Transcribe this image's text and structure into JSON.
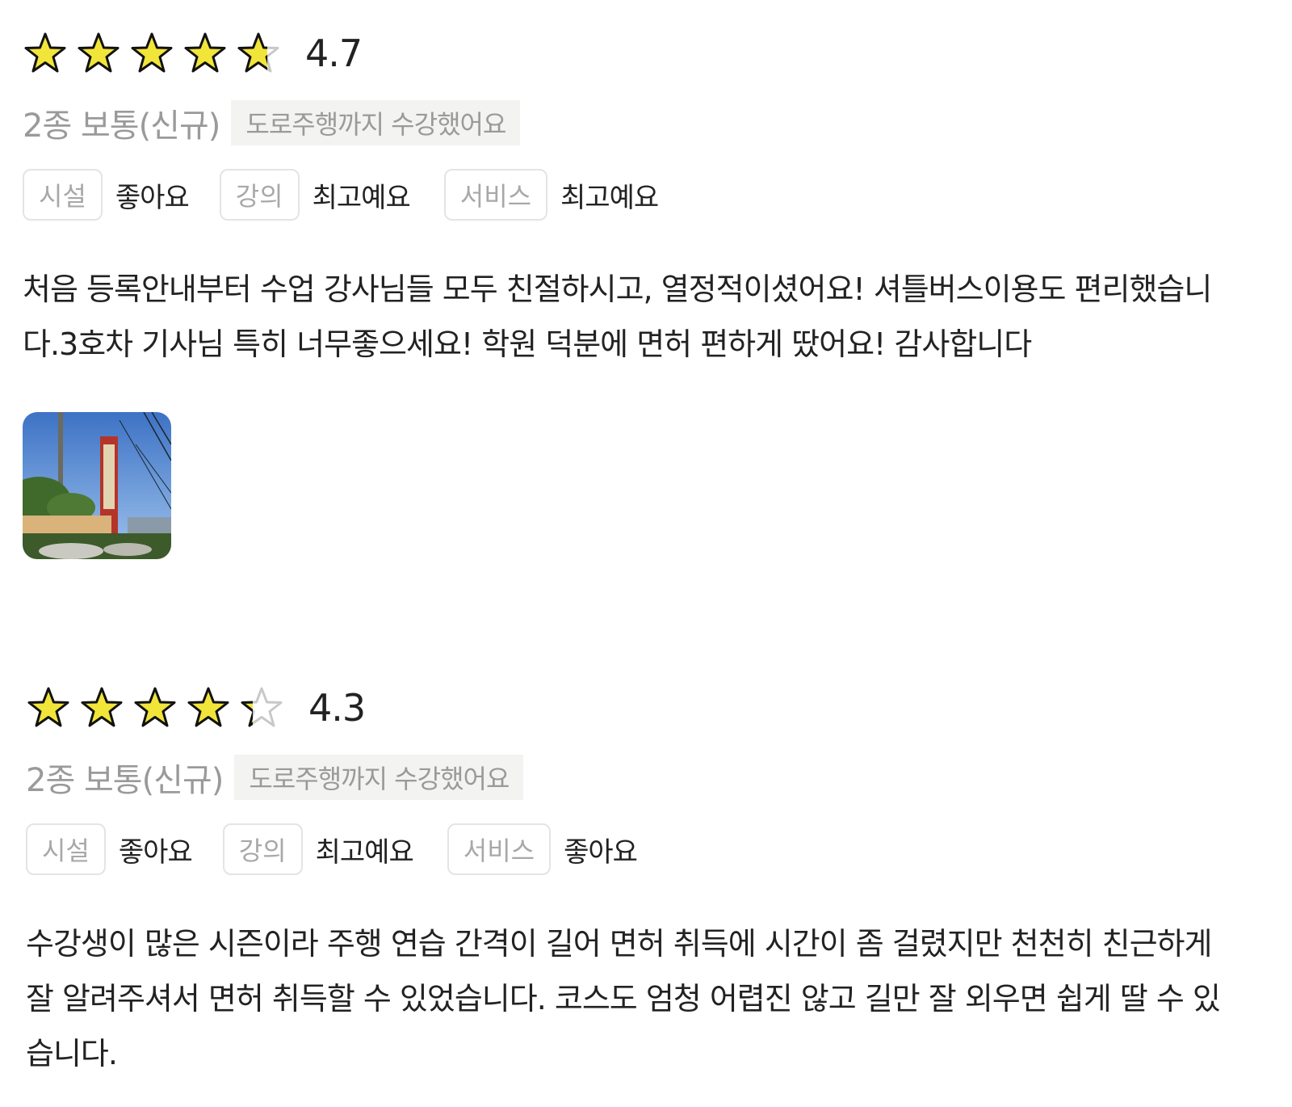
{
  "reviews": [
    {
      "rating": 4.7,
      "score_label": "4.7",
      "course": "2종 보통(신규)",
      "course_tag": "도로주행까지 수강했어요",
      "evaluations": [
        {
          "label": "시설",
          "value": "좋아요"
        },
        {
          "label": "강의",
          "value": "최고예요"
        },
        {
          "label": "서비스",
          "value": "최고예요"
        }
      ],
      "text": "처음 등록안내부터 수업 강사님들 모두 친절하시고, 열정적이셨어요! 셔틀버스이용도 편리했습니다.3호차 기사님 특히 너무좋으세요! 학원 덕분에 면허 편하게 땄어요! 감사합니다",
      "has_photo": true
    },
    {
      "rating": 4.3,
      "score_label": "4.3",
      "course": "2종 보통(신규)",
      "course_tag": "도로주행까지 수강했어요",
      "evaluations": [
        {
          "label": "시설",
          "value": "좋아요"
        },
        {
          "label": "강의",
          "value": "최고예요"
        },
        {
          "label": "서비스",
          "value": "좋아요"
        }
      ],
      "text": "수강생이 많은 시즌이라 주행 연습 간격이 길어 면허 취득에 시간이 좀 걸렸지만 천천히 친근하게 잘 알려주셔서 면허 취득할 수 있었습니다. 코스도 엄청 어렵진 않고 길만 잘 외우면 쉽게 딸 수 있습니다.",
      "has_photo": false
    }
  ],
  "colors": {
    "star_fill": "#f2e53a",
    "star_stroke": "#111111",
    "star_empty_stroke": "#c8c8c8",
    "muted_text": "#9a9a9a",
    "tag_bg": "#f3f3f1"
  },
  "icons": {
    "star": "star-icon",
    "photo": "review-photo"
  }
}
